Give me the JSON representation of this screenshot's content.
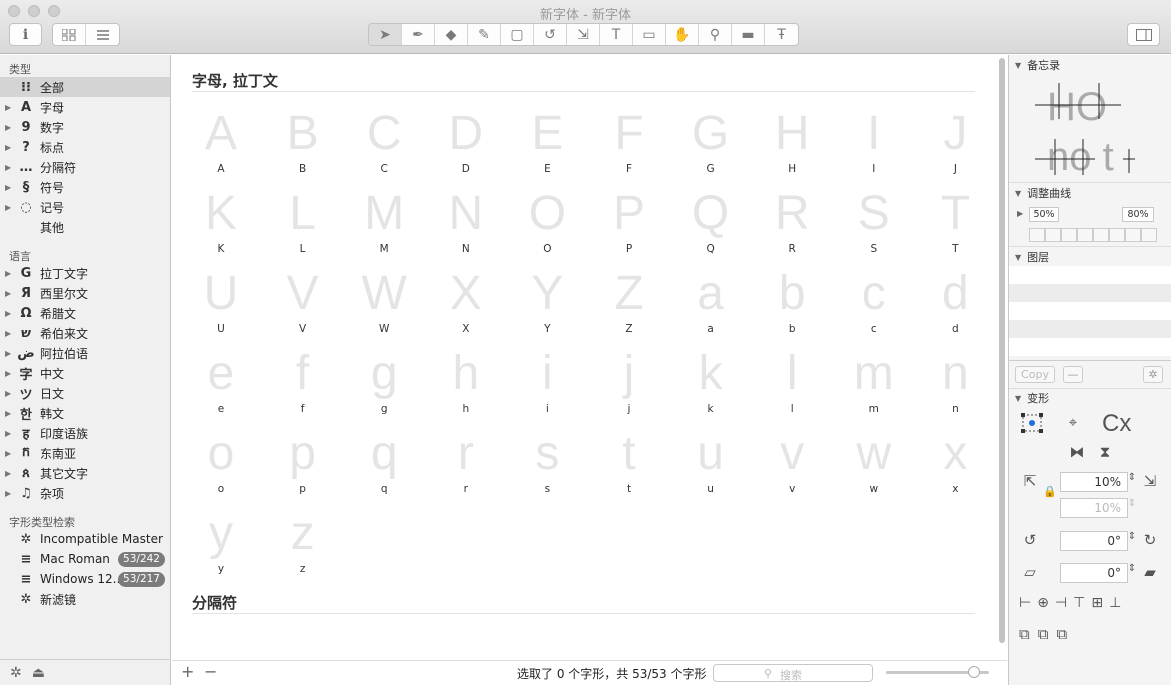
{
  "window": {
    "title": "新字体 - 新字体"
  },
  "toolbar": {
    "info_icon": "info-icon",
    "view_grid_icon": "grid-view-icon",
    "view_list_icon": "list-view-icon",
    "tools": [
      "select-tool-icon",
      "draw-tool-icon",
      "eraser-tool-icon",
      "pencil-tool-icon",
      "primitives-tool-icon",
      "rotate-tool-icon",
      "scale-tool-icon",
      "text-tool-icon",
      "annotation-tool-icon",
      "hand-tool-icon",
      "zoom-tool-icon",
      "measure-tool-icon",
      "type-tool-icon"
    ],
    "sidebar_toggle_icon": "sidebar-toggle-icon"
  },
  "sidebar": {
    "categories_header": "类型",
    "categories": [
      {
        "icon": "⁝⁝",
        "label": "全部"
      },
      {
        "icon": "A",
        "label": "字母"
      },
      {
        "icon": "9",
        "label": "数字"
      },
      {
        "icon": "?",
        "label": "标点"
      },
      {
        "icon": "…",
        "label": "分隔符"
      },
      {
        "icon": "§",
        "label": "符号"
      },
      {
        "icon": "◌",
        "label": "记号"
      },
      {
        "icon": "",
        "label": "其他"
      }
    ],
    "languages_header": "语言",
    "languages": [
      {
        "icon": "G",
        "label": "拉丁文字"
      },
      {
        "icon": "Я",
        "label": "西里尔文"
      },
      {
        "icon": "Ω",
        "label": "希腊文"
      },
      {
        "icon": "ש",
        "label": "希伯来文"
      },
      {
        "icon": "ض",
        "label": "阿拉伯语"
      },
      {
        "icon": "字",
        "label": "中文"
      },
      {
        "icon": "ツ",
        "label": "日文"
      },
      {
        "icon": "한",
        "label": "韩文"
      },
      {
        "icon": "ह",
        "label": "印度语族"
      },
      {
        "icon": "ក",
        "label": "东南亚"
      },
      {
        "icon": "ጰ",
        "label": "其它文字"
      },
      {
        "icon": "♫",
        "label": "杂项"
      }
    ],
    "filters_header": "字形类型检索",
    "filters": [
      {
        "icon": "✲",
        "label": "Incompatible Master",
        "badge": ""
      },
      {
        "icon": "≡",
        "label": "Mac Roman",
        "badge": "53/242"
      },
      {
        "icon": "≡",
        "label": "Windows 12...",
        "badge": "53/217"
      },
      {
        "icon": "✲",
        "label": "新滤镜",
        "badge": ""
      }
    ]
  },
  "main": {
    "section1": "字母, 拉丁文",
    "section2": "分隔符",
    "glyphs": [
      "A",
      "B",
      "C",
      "D",
      "E",
      "F",
      "G",
      "H",
      "I",
      "J",
      "K",
      "L",
      "M",
      "N",
      "O",
      "P",
      "Q",
      "R",
      "S",
      "T",
      "U",
      "V",
      "W",
      "X",
      "Y",
      "Z",
      "a",
      "b",
      "c",
      "d",
      "e",
      "f",
      "g",
      "h",
      "i",
      "j",
      "k",
      "l",
      "m",
      "n",
      "o",
      "p",
      "q",
      "r",
      "s",
      "t",
      "u",
      "v",
      "w",
      "x",
      "y",
      "z"
    ]
  },
  "status": {
    "add": "+",
    "remove": "−",
    "selection_text": "选取了 0 个字形，共 53/53 个字形",
    "search_placeholder": "搜索",
    "zoom_slider": 0.85
  },
  "inspector": {
    "notes_header": "备忘录",
    "curve_header": "调整曲线",
    "curve_left": "50%",
    "curve_right": "80%",
    "layers_header": "图层",
    "copy_label": "Copy",
    "transform_header": "变形",
    "scale_value": "10%",
    "scale_value_dim": "10%",
    "rotate_value": "0°",
    "slant_value": "0°",
    "preview_top": "HO",
    "preview_bottom": "no t",
    "cx_label": "Cx"
  }
}
